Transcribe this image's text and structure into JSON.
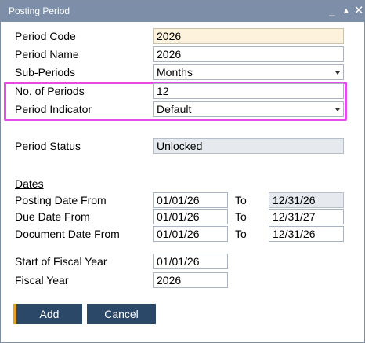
{
  "window": {
    "title": "Posting Period",
    "minimize_icon": "minimize-icon",
    "maximize_icon": "maximize-icon",
    "close_icon": "close-icon"
  },
  "form": {
    "period_code": {
      "label": "Period Code",
      "value": "2026"
    },
    "period_name": {
      "label": "Period Name",
      "value": "2026"
    },
    "sub_periods": {
      "label": "Sub-Periods",
      "value": "Months"
    },
    "no_of_periods": {
      "label": "No. of Periods",
      "value": "12"
    },
    "period_indicator": {
      "label": "Period Indicator",
      "value": "Default"
    },
    "period_status": {
      "label": "Period Status",
      "value": "Unlocked"
    },
    "dates": {
      "section_label": "Dates",
      "to_label": "To",
      "posting": {
        "label": "Posting Date From",
        "from": "01/01/26",
        "to": "12/31/26"
      },
      "due": {
        "label": "Due Date From",
        "from": "01/01/26",
        "to": "12/31/27"
      },
      "document": {
        "label": "Document Date From",
        "from": "01/01/26",
        "to": "12/31/26"
      }
    },
    "start_fiscal_year": {
      "label": "Start of Fiscal Year",
      "value": "01/01/26"
    },
    "fiscal_year": {
      "label": "Fiscal Year",
      "value": "2026"
    }
  },
  "buttons": {
    "add": "Add",
    "cancel": "Cancel"
  },
  "colors": {
    "titlebar": "#7d8fa8",
    "button": "#2b4869",
    "button_accent": "#e8a21c",
    "highlight": "#e14de6",
    "key_field": "#fdf3dc",
    "readonly_field": "#e6e9ed"
  }
}
